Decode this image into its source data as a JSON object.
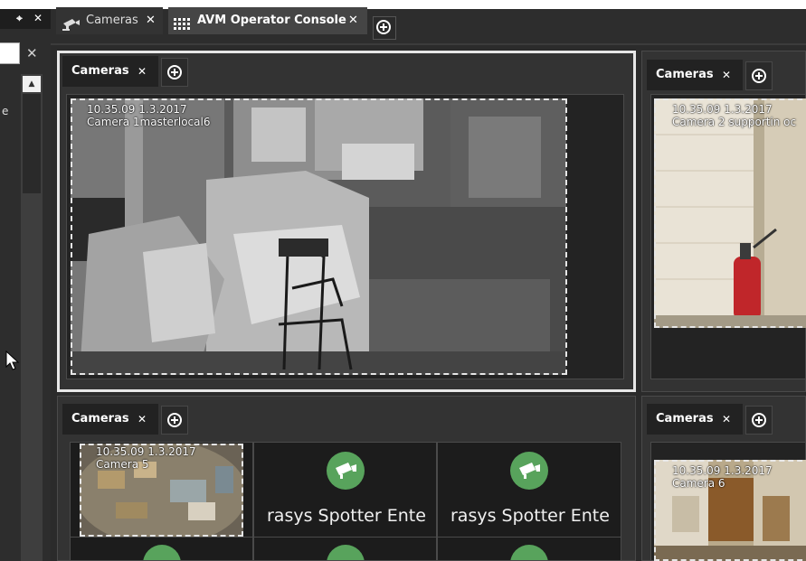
{
  "window_tabs": [
    {
      "label": "Cameras",
      "active": false
    },
    {
      "label": "AVM Operator Console",
      "active": true
    }
  ],
  "dock": {
    "partial_label": "e"
  },
  "icons": {
    "pin": "pin-icon",
    "close": "close-icon",
    "add": "add-tab-icon",
    "camera": "camera-icon",
    "grid": "grid-icon"
  },
  "panels": {
    "tab_label": "Cameras",
    "close_glyph": "✕"
  },
  "cameras": {
    "main": {
      "timestamp": "10.35.09  1.3.2017",
      "name": "Camera 1masterlocal6"
    },
    "right_top": {
      "timestamp": "10.35.09  1.3.2017",
      "name": "Camera 2 supportin oc"
    },
    "bottom_left": {
      "timestamp": "10.35.09  1.3.2017",
      "name": "Camera 5"
    },
    "bottom_right": {
      "timestamp": "10.35.09  1.3.2017",
      "name": "Camera 6"
    }
  },
  "empty_cell_label": "rasys Spotter Ente",
  "colors": {
    "background": "#2b2b2b",
    "accent_green": "#58a35c",
    "selected_border": "#e7e7e7"
  }
}
